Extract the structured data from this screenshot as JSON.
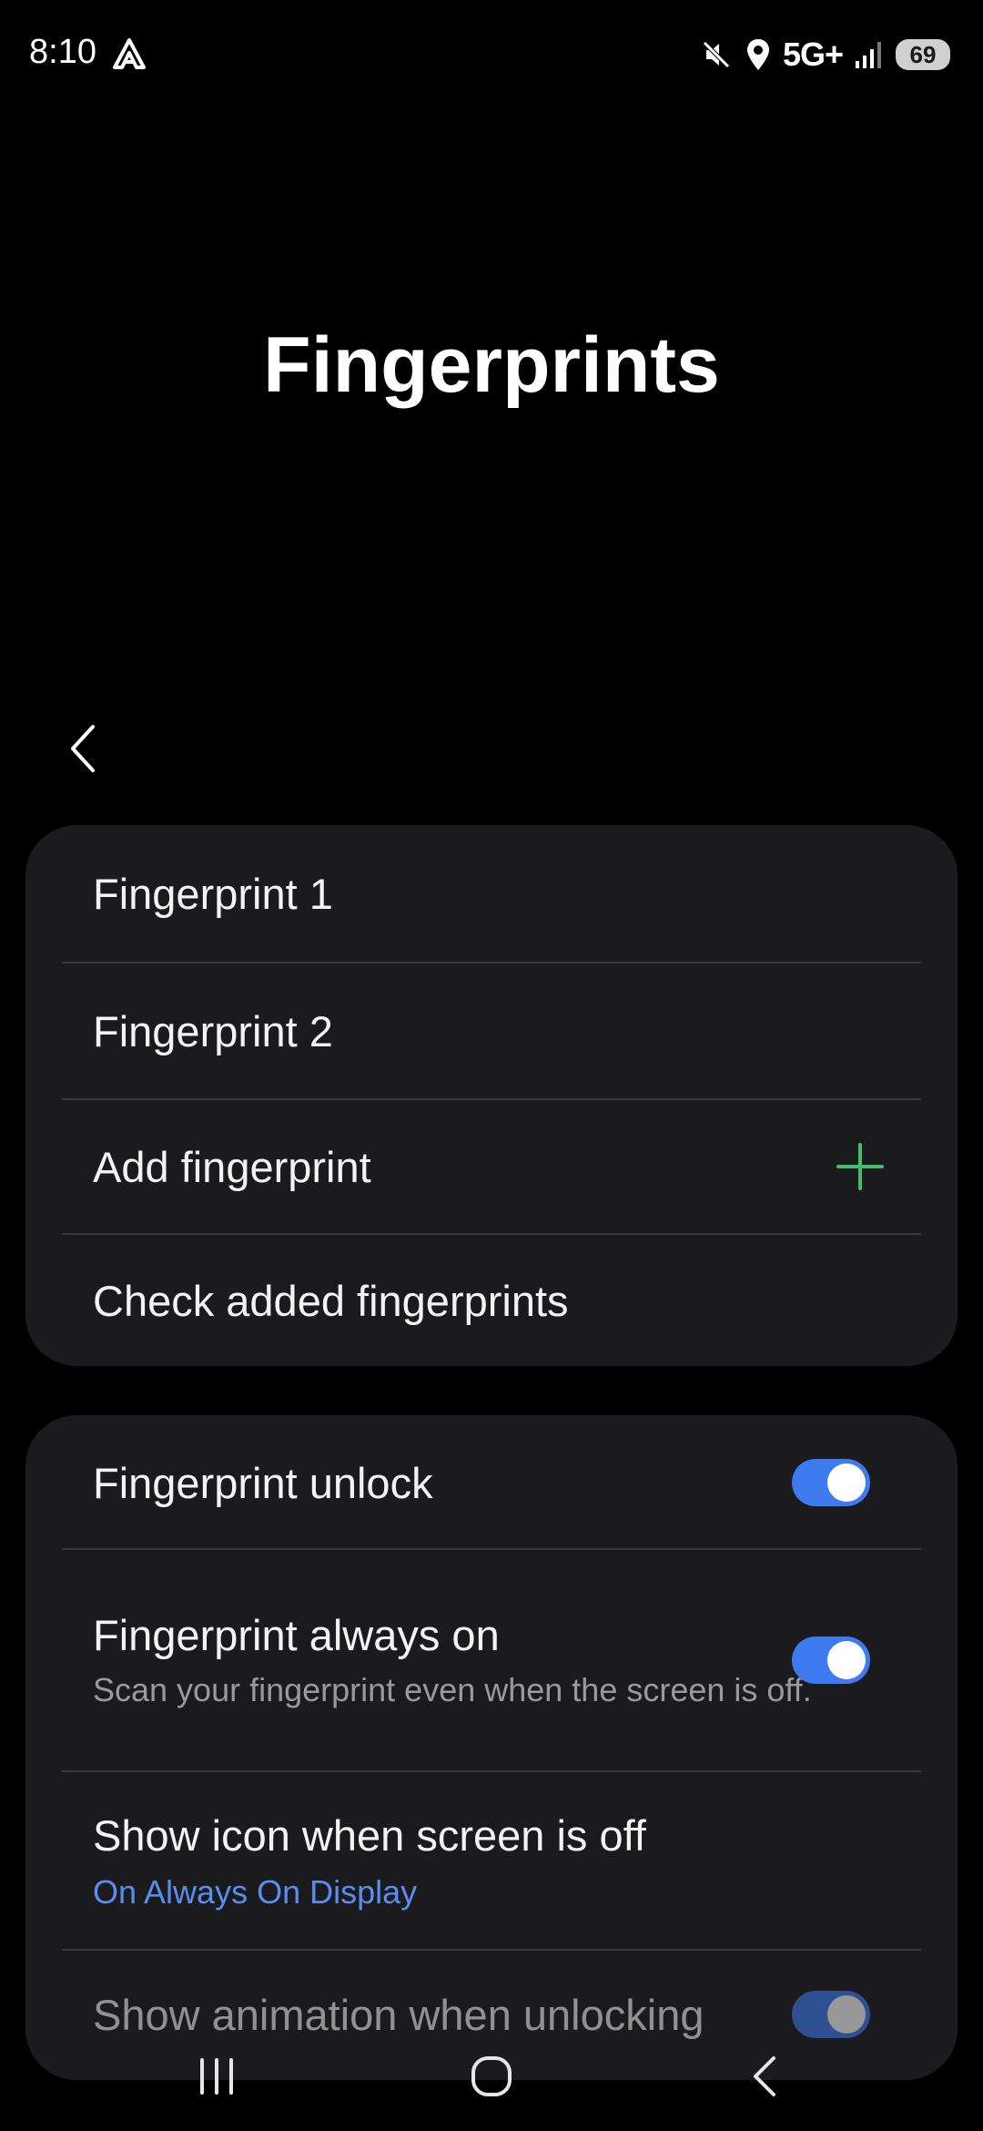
{
  "status_bar": {
    "time": "8:10",
    "network": "5G+",
    "battery": "69",
    "icons": [
      "app-notification-icon",
      "mute-icon",
      "location-icon",
      "signal-icon"
    ]
  },
  "title": "Fingerprints",
  "fingerprints_card": {
    "items": [
      {
        "label": "Fingerprint 1"
      },
      {
        "label": "Fingerprint 2"
      },
      {
        "label": "Add fingerprint",
        "icon": "plus-icon"
      },
      {
        "label": "Check added fingerprints"
      }
    ]
  },
  "settings_card": {
    "items": [
      {
        "label": "Fingerprint unlock",
        "toggle": true
      },
      {
        "label": "Fingerprint always on",
        "description": "Scan your fingerprint even when the screen is off.",
        "toggle": true
      },
      {
        "label": "Show icon when screen is off",
        "value": "On Always On Display"
      },
      {
        "label": "Show animation when unlocking",
        "toggle": true
      }
    ]
  },
  "navigation": {
    "buttons": [
      "recent-apps-icon",
      "home-icon",
      "back-icon"
    ]
  },
  "colors": {
    "background": "#000000",
    "card": "#1b1b1d",
    "accent": "#3e7bf0",
    "link": "#5a8df0",
    "plus": "#3fbf6a"
  }
}
